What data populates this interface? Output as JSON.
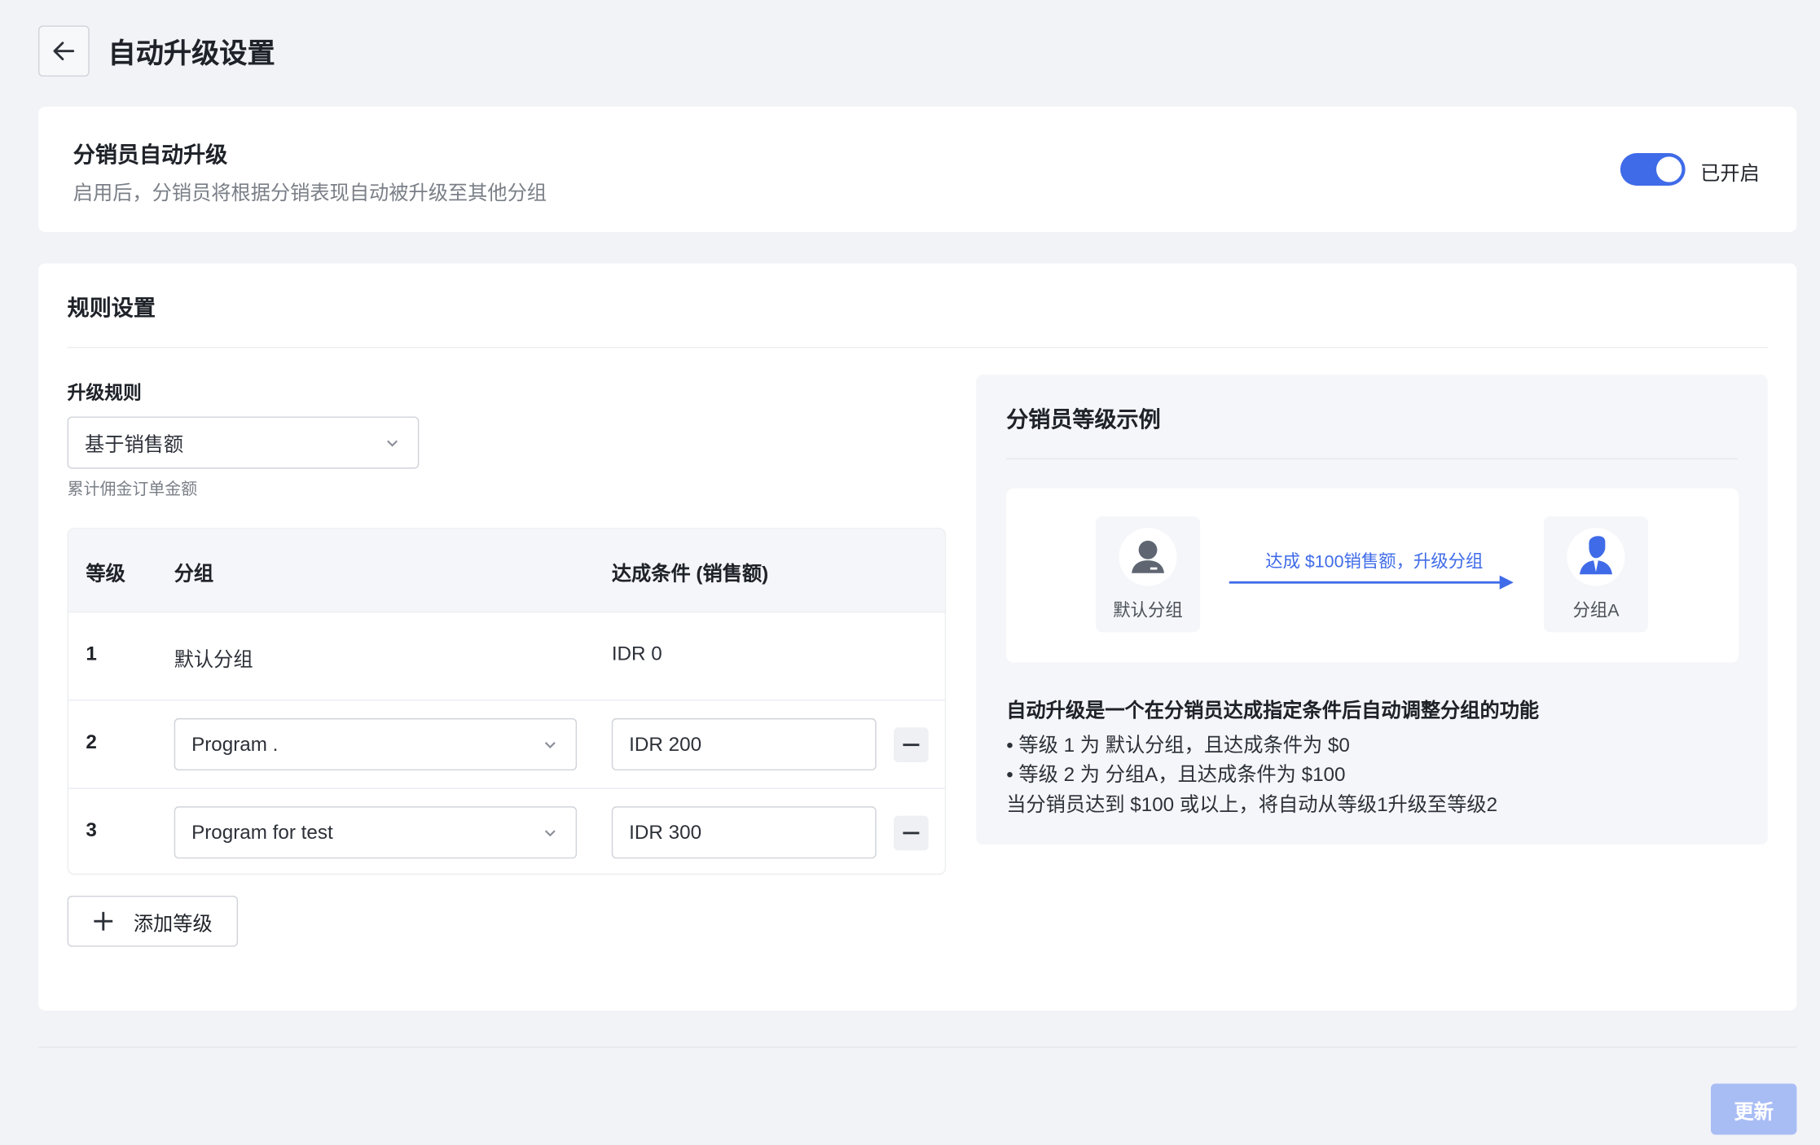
{
  "header": {
    "title": "自动升级设置"
  },
  "auto_upgrade": {
    "title": "分销员自动升级",
    "description": "启用后，分销员将根据分销表现自动被升级至其他分组",
    "toggle_on": true,
    "toggle_label": "已开启"
  },
  "rules": {
    "title": "规则设置",
    "rule_label": "升级规则",
    "rule_selected": "基于销售额",
    "rule_hint": "累计佣金订单金额",
    "table": {
      "columns": [
        "等级",
        "分组",
        "达成条件 (销售额)"
      ],
      "rows": [
        {
          "level": "1",
          "group": "默认分组",
          "condition": "IDR 0"
        },
        {
          "level": "2",
          "group": "Program .",
          "condition": "IDR 200"
        },
        {
          "level": "3",
          "group": "Program for test",
          "condition": "IDR 300"
        }
      ]
    },
    "add_level_label": "添加等级"
  },
  "example": {
    "title": "分销员等级示例",
    "from_group": "默认分组",
    "to_group": "分组A",
    "arrow_text": "达成 $100销售额，升级分组",
    "desc_title": "自动升级是一个在分销员达成指定条件后自动调整分组的功能",
    "line1": "• 等级 1 为 默认分组，且达成条件为 $0",
    "line2": "• 等级 2 为 分组A，且达成条件为 $100",
    "line3": "当分销员达到 $100 或以上，将自动从等级1升级至等级2"
  },
  "footer": {
    "update_label": "更新"
  },
  "colors": {
    "accent": "#3f6be8",
    "update_disabled": "#a9bdf5",
    "background": "#f2f3f7"
  }
}
